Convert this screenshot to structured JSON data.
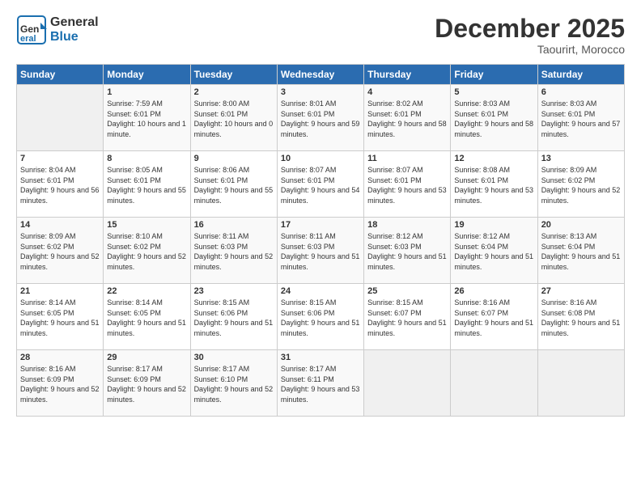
{
  "logo": {
    "general": "General",
    "blue": "Blue"
  },
  "title": "December 2025",
  "location": "Taourirt, Morocco",
  "days_header": [
    "Sunday",
    "Monday",
    "Tuesday",
    "Wednesday",
    "Thursday",
    "Friday",
    "Saturday"
  ],
  "weeks": [
    [
      {
        "day": "",
        "empty": true
      },
      {
        "day": "1",
        "sunrise": "7:59 AM",
        "sunset": "6:01 PM",
        "daylight": "10 hours and 1 minute."
      },
      {
        "day": "2",
        "sunrise": "8:00 AM",
        "sunset": "6:01 PM",
        "daylight": "10 hours and 0 minutes."
      },
      {
        "day": "3",
        "sunrise": "8:01 AM",
        "sunset": "6:01 PM",
        "daylight": "9 hours and 59 minutes."
      },
      {
        "day": "4",
        "sunrise": "8:02 AM",
        "sunset": "6:01 PM",
        "daylight": "9 hours and 58 minutes."
      },
      {
        "day": "5",
        "sunrise": "8:03 AM",
        "sunset": "6:01 PM",
        "daylight": "9 hours and 58 minutes."
      },
      {
        "day": "6",
        "sunrise": "8:03 AM",
        "sunset": "6:01 PM",
        "daylight": "9 hours and 57 minutes."
      }
    ],
    [
      {
        "day": "7",
        "sunrise": "8:04 AM",
        "sunset": "6:01 PM",
        "daylight": "9 hours and 56 minutes."
      },
      {
        "day": "8",
        "sunrise": "8:05 AM",
        "sunset": "6:01 PM",
        "daylight": "9 hours and 55 minutes."
      },
      {
        "day": "9",
        "sunrise": "8:06 AM",
        "sunset": "6:01 PM",
        "daylight": "9 hours and 55 minutes."
      },
      {
        "day": "10",
        "sunrise": "8:07 AM",
        "sunset": "6:01 PM",
        "daylight": "9 hours and 54 minutes."
      },
      {
        "day": "11",
        "sunrise": "8:07 AM",
        "sunset": "6:01 PM",
        "daylight": "9 hours and 53 minutes."
      },
      {
        "day": "12",
        "sunrise": "8:08 AM",
        "sunset": "6:01 PM",
        "daylight": "9 hours and 53 minutes."
      },
      {
        "day": "13",
        "sunrise": "8:09 AM",
        "sunset": "6:02 PM",
        "daylight": "9 hours and 52 minutes."
      }
    ],
    [
      {
        "day": "14",
        "sunrise": "8:09 AM",
        "sunset": "6:02 PM",
        "daylight": "9 hours and 52 minutes."
      },
      {
        "day": "15",
        "sunrise": "8:10 AM",
        "sunset": "6:02 PM",
        "daylight": "9 hours and 52 minutes."
      },
      {
        "day": "16",
        "sunrise": "8:11 AM",
        "sunset": "6:03 PM",
        "daylight": "9 hours and 52 minutes."
      },
      {
        "day": "17",
        "sunrise": "8:11 AM",
        "sunset": "6:03 PM",
        "daylight": "9 hours and 51 minutes."
      },
      {
        "day": "18",
        "sunrise": "8:12 AM",
        "sunset": "6:03 PM",
        "daylight": "9 hours and 51 minutes."
      },
      {
        "day": "19",
        "sunrise": "8:12 AM",
        "sunset": "6:04 PM",
        "daylight": "9 hours and 51 minutes."
      },
      {
        "day": "20",
        "sunrise": "8:13 AM",
        "sunset": "6:04 PM",
        "daylight": "9 hours and 51 minutes."
      }
    ],
    [
      {
        "day": "21",
        "sunrise": "8:14 AM",
        "sunset": "6:05 PM",
        "daylight": "9 hours and 51 minutes."
      },
      {
        "day": "22",
        "sunrise": "8:14 AM",
        "sunset": "6:05 PM",
        "daylight": "9 hours and 51 minutes."
      },
      {
        "day": "23",
        "sunrise": "8:15 AM",
        "sunset": "6:06 PM",
        "daylight": "9 hours and 51 minutes."
      },
      {
        "day": "24",
        "sunrise": "8:15 AM",
        "sunset": "6:06 PM",
        "daylight": "9 hours and 51 minutes."
      },
      {
        "day": "25",
        "sunrise": "8:15 AM",
        "sunset": "6:07 PM",
        "daylight": "9 hours and 51 minutes."
      },
      {
        "day": "26",
        "sunrise": "8:16 AM",
        "sunset": "6:07 PM",
        "daylight": "9 hours and 51 minutes."
      },
      {
        "day": "27",
        "sunrise": "8:16 AM",
        "sunset": "6:08 PM",
        "daylight": "9 hours and 51 minutes."
      }
    ],
    [
      {
        "day": "28",
        "sunrise": "8:16 AM",
        "sunset": "6:09 PM",
        "daylight": "9 hours and 52 minutes."
      },
      {
        "day": "29",
        "sunrise": "8:17 AM",
        "sunset": "6:09 PM",
        "daylight": "9 hours and 52 minutes."
      },
      {
        "day": "30",
        "sunrise": "8:17 AM",
        "sunset": "6:10 PM",
        "daylight": "9 hours and 52 minutes."
      },
      {
        "day": "31",
        "sunrise": "8:17 AM",
        "sunset": "6:11 PM",
        "daylight": "9 hours and 53 minutes."
      },
      {
        "day": "",
        "empty": true
      },
      {
        "day": "",
        "empty": true
      },
      {
        "day": "",
        "empty": true
      }
    ]
  ]
}
